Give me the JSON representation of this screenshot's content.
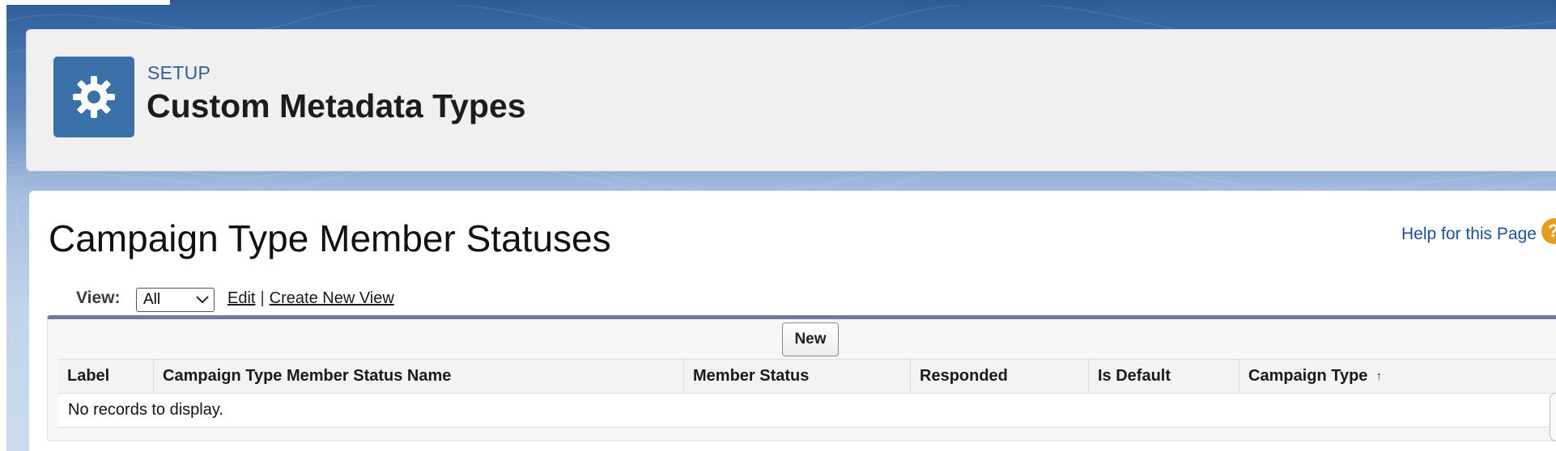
{
  "header": {
    "breadcrumb": "SETUP",
    "title": "Custom Metadata Types",
    "icon": "gear-icon"
  },
  "page": {
    "title": "Campaign Type Member Statuses",
    "help_link": "Help for this Page",
    "help_icon": "?"
  },
  "view": {
    "label": "View:",
    "selected": "All",
    "edit_link": "Edit",
    "separator": "|",
    "create_link": "Create New View"
  },
  "toolbar": {
    "new_label": "New"
  },
  "table": {
    "columns": [
      "Label",
      "Campaign Type Member Status Name",
      "Member Status",
      "Responded",
      "Is Default",
      "Campaign Type"
    ],
    "sort_indicator": "↑",
    "empty_message": "No records to display."
  },
  "colors": {
    "brand_blue": "#3a71a8",
    "link_blue": "#1b5297",
    "help_orange": "#e59e23"
  }
}
